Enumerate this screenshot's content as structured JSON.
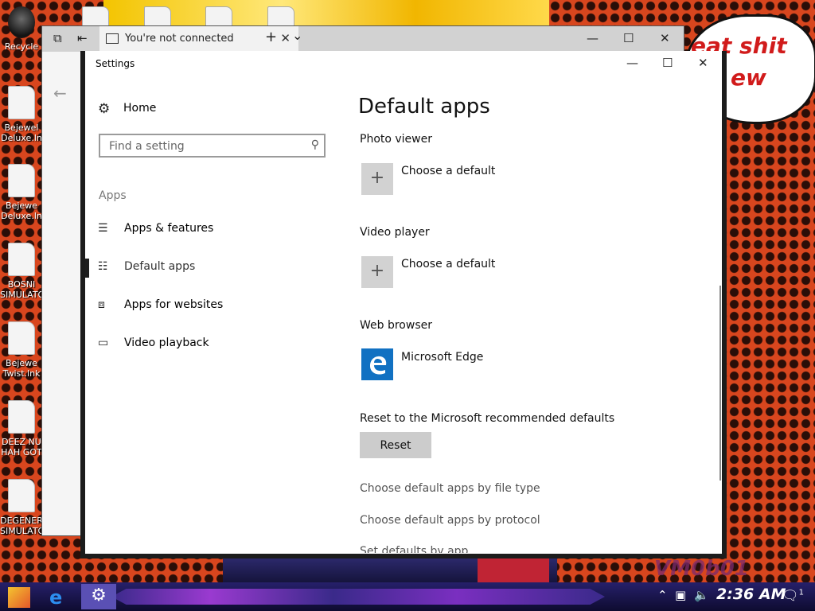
{
  "wallpaper": {
    "speech_lines": [
      "eat shit",
      "ew"
    ],
    "watermark": "VM0b01"
  },
  "desktop_icons": [
    {
      "label": "Recycle"
    },
    {
      "label": "Bejewel Deluxe.ln"
    },
    {
      "label": "Bejewe Deluxe.ln"
    },
    {
      "label": "BOSNI SIMULATO"
    },
    {
      "label": "Bejewe Twist.lnk"
    },
    {
      "label": "DEEZ NU HAH GOT"
    },
    {
      "label": "DEGENER SIMULATOR..."
    }
  ],
  "edge_window": {
    "tab_title": "You're not connected",
    "new_tab": "+",
    "tab_list": "⌄",
    "minimize": "—",
    "maximize": "☐",
    "close": "✕",
    "back": "←"
  },
  "settings": {
    "window_title": "Settings",
    "minimize": "—",
    "maximize": "☐",
    "close": "✕",
    "home_label": "Home",
    "search_placeholder": "Find a setting",
    "section_label": "Apps",
    "nav_items": [
      {
        "label": "Apps & features",
        "icon": "list-icon"
      },
      {
        "label": "Default apps",
        "icon": "default-apps-icon",
        "active": true
      },
      {
        "label": "Apps for websites",
        "icon": "apps-for-websites-icon"
      },
      {
        "label": "Video playback",
        "icon": "video-icon"
      }
    ],
    "page_title": "Default apps",
    "categories": [
      {
        "label": "Photo viewer",
        "app": "Choose a default"
      },
      {
        "label": "Video player",
        "app": "Choose a default"
      },
      {
        "label": "Web browser",
        "app": "Microsoft Edge"
      }
    ],
    "reset_label": "Reset to the Microsoft recommended defaults",
    "reset_button": "Reset",
    "links": [
      "Choose default apps by file type",
      "Choose default apps by protocol",
      "Set defaults by app"
    ]
  },
  "taskbar": {
    "clock": "2:36 AM",
    "notification_count": "1"
  },
  "colors": {
    "edge_blue": "#1171c2",
    "wallpaper_red": "#d8461e",
    "taskbar": "#1a1450"
  }
}
